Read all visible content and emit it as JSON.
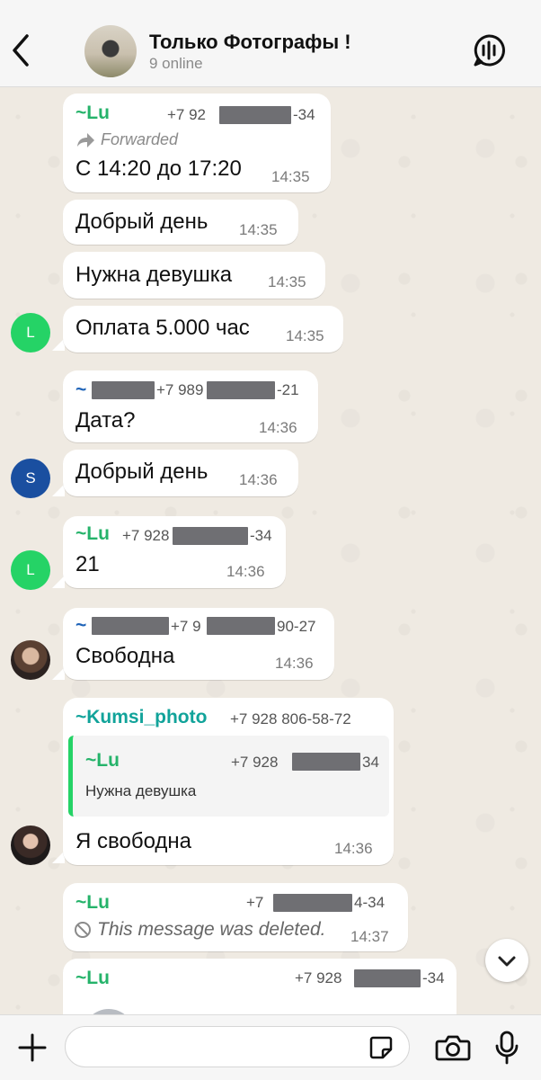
{
  "header": {
    "title": "Только Фотографы !",
    "subtitle": "9 online"
  },
  "messages": [
    {
      "sender": "~Lu",
      "phone": "+7 92",
      "phone_end": "-34",
      "forwarded": "Forwarded",
      "text": "С 14:20 до 17:20",
      "time": "14:35"
    },
    {
      "text": "Добрый день",
      "time": "14:35"
    },
    {
      "text": "Нужна девушка",
      "time": "14:35"
    },
    {
      "avatar": "L",
      "text": "Оплата 5.000 час",
      "time": "14:35"
    },
    {
      "sender": "~",
      "phone": "+7 989",
      "phone_end": "-21",
      "text": "Дата?",
      "time": "14:36"
    },
    {
      "avatar": "S",
      "text": "Добрый день",
      "time": "14:36"
    },
    {
      "sender": "~Lu",
      "phone": "+7 928",
      "phone_end": "-34",
      "text": "21",
      "time": "14:36"
    },
    {
      "avatar": "L"
    },
    {
      "sender": "~",
      "phone": "+7 9",
      "phone_end": "90-27",
      "text": "Свободна",
      "time": "14:36"
    },
    {
      "sender": "~Kumsi_photo",
      "phone": "+7 928 806-58-72",
      "quote_sender": "~Lu",
      "quote_phone": "+7 928",
      "quote_phone_end": "34",
      "quote_text": "Нужна девушка",
      "text": "Я свободна",
      "time": "14:36"
    },
    {
      "sender": "~Lu",
      "phone": "+7",
      "phone_end": "4-34",
      "text": "This message was deleted.",
      "time": "14:37"
    },
    {
      "sender": "~Lu",
      "phone": "+7 928",
      "phone_end": "-34"
    }
  ],
  "colors": {
    "green_name": "#25b36a",
    "blue_name": "#1e63b8",
    "teal_name": "#11a39a",
    "avatar_green": "#25d366",
    "avatar_blue": "#1a4fa0"
  },
  "icons": {
    "back": "chevron-left-icon",
    "call": "voice-chat-icon",
    "add": "plus-icon",
    "sticker": "sticker-icon",
    "camera": "camera-icon",
    "mic": "microphone-icon",
    "scroll": "chevron-down-icon"
  }
}
